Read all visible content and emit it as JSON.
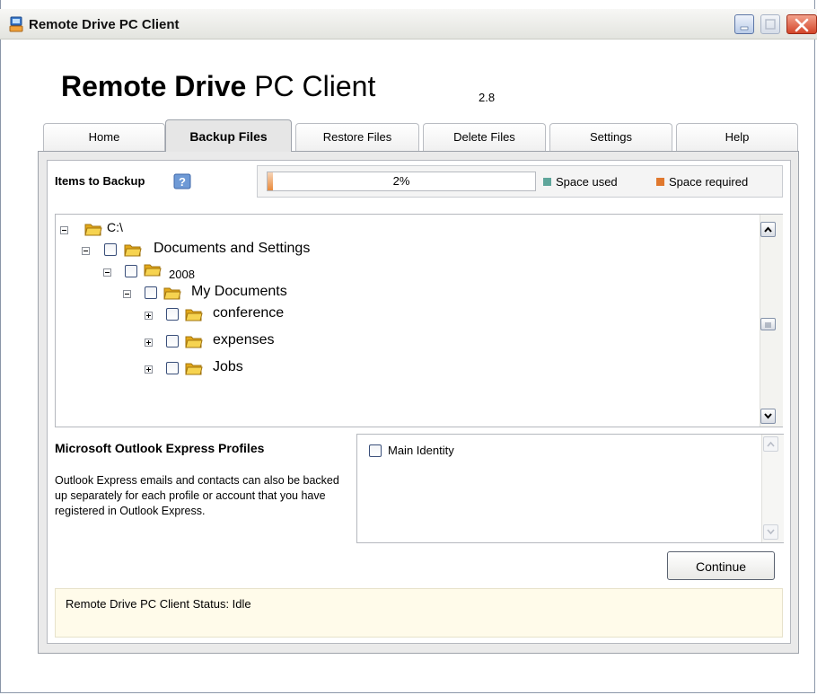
{
  "window": {
    "title": "Remote Drive PC Client"
  },
  "header": {
    "title_bold": "Remote Drive",
    "title_light": "PC Client",
    "version": "2.8"
  },
  "tabs": [
    {
      "label": "Home",
      "active": false
    },
    {
      "label": "Backup Files",
      "active": true
    },
    {
      "label": "Restore Files",
      "active": false
    },
    {
      "label": "Delete Files",
      "active": false
    },
    {
      "label": "Settings",
      "active": false
    },
    {
      "label": "Help",
      "active": false
    }
  ],
  "backup": {
    "items_label": "Items to Backup",
    "progress": {
      "percent_text": "2%",
      "fraction": 0.02
    },
    "legend": {
      "used_label": "Space used",
      "used_color": "#5fa69b",
      "required_label": "Space required",
      "required_color": "#e0782e"
    }
  },
  "tree": {
    "nodes": [
      {
        "label": "C:\\",
        "expanded": true,
        "checkbox": false
      },
      {
        "label": "Documents and Settings",
        "expanded": true,
        "checkbox": true
      },
      {
        "label": "2008",
        "expanded": true,
        "checkbox": true
      },
      {
        "label": "My Documents",
        "expanded": true,
        "checkbox": true
      },
      {
        "label": "conference",
        "expanded": false,
        "checkbox": true
      },
      {
        "label": "expenses",
        "expanded": false,
        "checkbox": true
      },
      {
        "label": "Jobs",
        "expanded": false,
        "checkbox": true
      }
    ]
  },
  "outlook": {
    "title": "Microsoft Outlook Express Profiles",
    "description": "Outlook Express emails and contacts can also be backed up separately for each profile or account that you have registered in Outlook Express.",
    "profiles": [
      {
        "label": "Main Identity",
        "checked": false
      }
    ]
  },
  "continue_label": "Continue",
  "status": {
    "text": "Remote Drive PC Client Status: Idle"
  },
  "colors": {
    "accent_folder": "#f2c230",
    "status_background": "#fffbea",
    "progress_fill": "#e98a3b"
  }
}
